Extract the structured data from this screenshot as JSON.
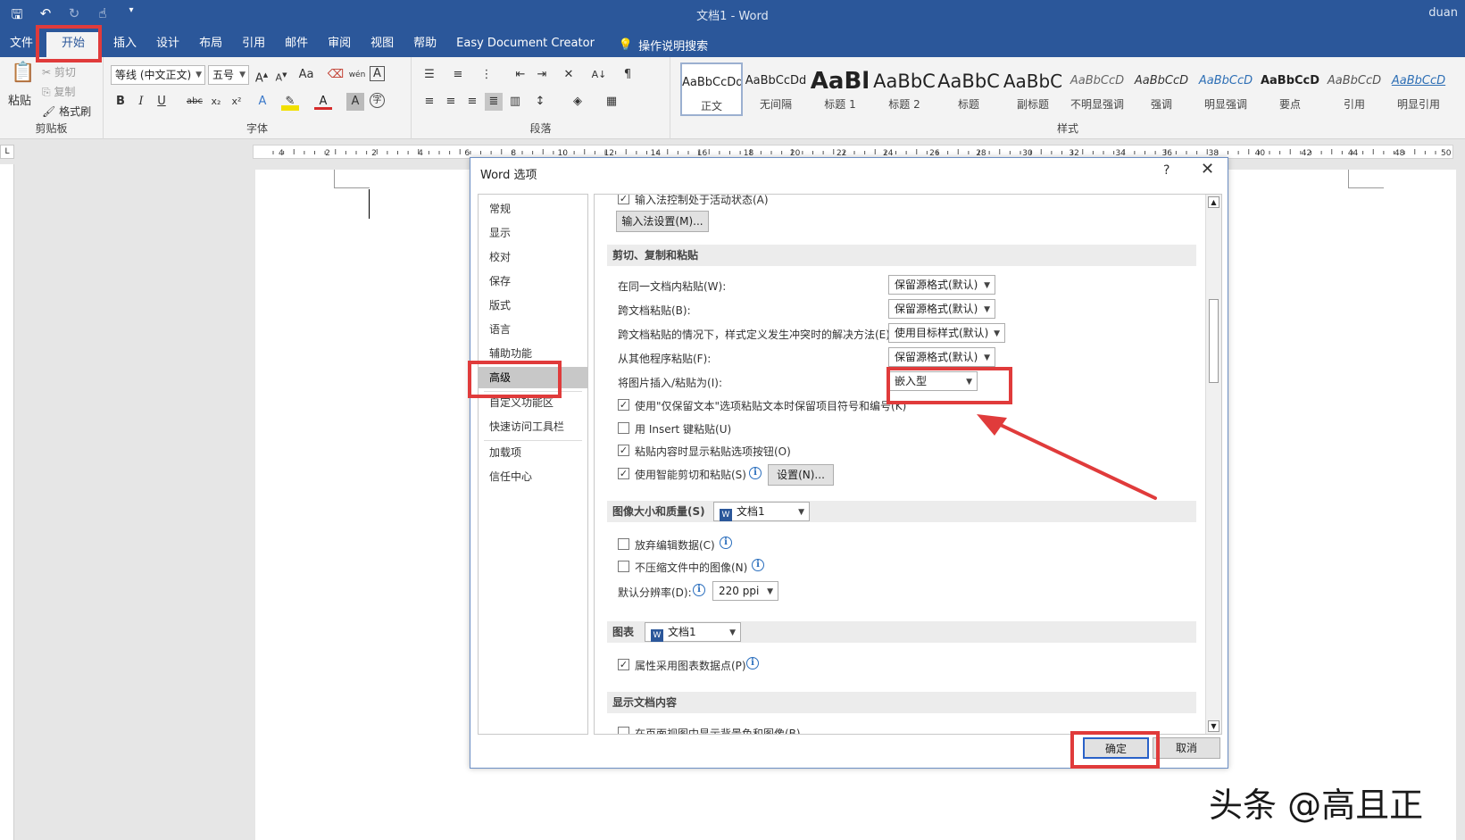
{
  "titlebar": {
    "doc_title": "文档1 - Word",
    "user": "duan",
    "qat_icons": [
      "save-icon",
      "undo-icon",
      "redo-icon",
      "touch-mode-icon",
      "customize-icon"
    ]
  },
  "tabs": [
    "文件",
    "开始",
    "插入",
    "设计",
    "布局",
    "引用",
    "邮件",
    "审阅",
    "视图",
    "帮助",
    "Easy Document Creator"
  ],
  "tabs_active": "开始",
  "tell_me": "操作说明搜索",
  "ribbon": {
    "clipboard": {
      "label": "剪贴板",
      "paste": "粘贴",
      "cut": "剪切",
      "copy": "复制",
      "format_painter": "格式刷"
    },
    "font": {
      "label": "字体",
      "family": "等线 (中文正文)",
      "size": "五号",
      "case": "Aa",
      "phonetic": "wén"
    },
    "paragraph": {
      "label": "段落"
    },
    "styles": {
      "label": "样式",
      "items": [
        {
          "sample": "AaBbCcDd",
          "name": "正文"
        },
        {
          "sample": "AaBbCcDd",
          "name": "无间隔"
        },
        {
          "sample": "AaBl",
          "name": "标题 1"
        },
        {
          "sample": "AaBbC",
          "name": "标题 2"
        },
        {
          "sample": "AaBbC",
          "name": "标题"
        },
        {
          "sample": "AaBbC",
          "name": "副标题"
        },
        {
          "sample": "AaBbCcD",
          "name": "不明显强调"
        },
        {
          "sample": "AaBbCcD",
          "name": "强调"
        },
        {
          "sample": "AaBbCcD",
          "name": "明显强调"
        },
        {
          "sample": "AaBbCcD",
          "name": "要点"
        },
        {
          "sample": "AaBbCcD",
          "name": "引用"
        },
        {
          "sample": "AaBbCcD",
          "name": "明显引用"
        }
      ]
    }
  },
  "ruler": {
    "labels": [
      "4",
      "2",
      "2",
      "4",
      "6",
      "8",
      "10",
      "12",
      "14",
      "16",
      "18",
      "20",
      "22",
      "24",
      "26",
      "28",
      "30",
      "32",
      "34",
      "36",
      "38",
      "40",
      "42",
      "44",
      "48",
      "50"
    ]
  },
  "dialog": {
    "title": "Word 选项",
    "help": "?",
    "nav": [
      "常规",
      "显示",
      "校对",
      "保存",
      "版式",
      "语言",
      "辅助功能",
      "高级",
      "自定义功能区",
      "快速访问工具栏",
      "加载项",
      "信任中心"
    ],
    "nav_selected": "高级",
    "top_option": "输入法控制处于活动状态(A)",
    "ime_settings_btn": "输入法设置(M)...",
    "cut_copy_paste": {
      "heading": "剪切、复制和粘贴",
      "rows": [
        {
          "label": "在同一文档内粘贴(W):",
          "value": "保留源格式(默认)"
        },
        {
          "label": "跨文档粘贴(B):",
          "value": "保留源格式(默认)"
        },
        {
          "label": "跨文档粘贴的情况下，样式定义发生冲突时的解决方法(E):",
          "value": "使用目标样式(默认)"
        },
        {
          "label": "从其他程序粘贴(F):",
          "value": "保留源格式(默认)"
        },
        {
          "label": "将图片插入/粘贴为(I):",
          "value": "嵌入型"
        }
      ],
      "checks": [
        {
          "label": "使用\"仅保留文本\"选项粘贴文本时保留项目符号和编号(K)",
          "checked": true
        },
        {
          "label": "用 Insert 键粘贴(U)",
          "checked": false
        },
        {
          "label": "粘贴内容时显示粘贴选项按钮(O)",
          "checked": true
        },
        {
          "label": "使用智能剪切和粘贴(S)",
          "checked": true
        }
      ],
      "settings_btn": "设置(N)..."
    },
    "image_quality": {
      "heading": "图像大小和质量(S)",
      "doc": "文档1",
      "checks": [
        {
          "label": "放弃编辑数据(C)",
          "checked": false
        },
        {
          "label": "不压缩文件中的图像(N)",
          "checked": false
        }
      ],
      "resolution_label": "默认分辨率(D):",
      "resolution": "220 ppi"
    },
    "chart": {
      "heading": "图表",
      "doc": "文档1",
      "check": {
        "label": "属性采用图表数据点(P)",
        "checked": true
      }
    },
    "display": {
      "heading": "显示文档内容",
      "check": {
        "label": "在页面视图中显示背景色和图像(B)",
        "checked": false
      }
    },
    "ok": "确定",
    "cancel": "取消"
  },
  "watermark": "头条 @高且正",
  "colors": {
    "title_bar": "#2b579a",
    "annotation_red": "#e03b3b",
    "info_blue": "#2a6ebd"
  }
}
